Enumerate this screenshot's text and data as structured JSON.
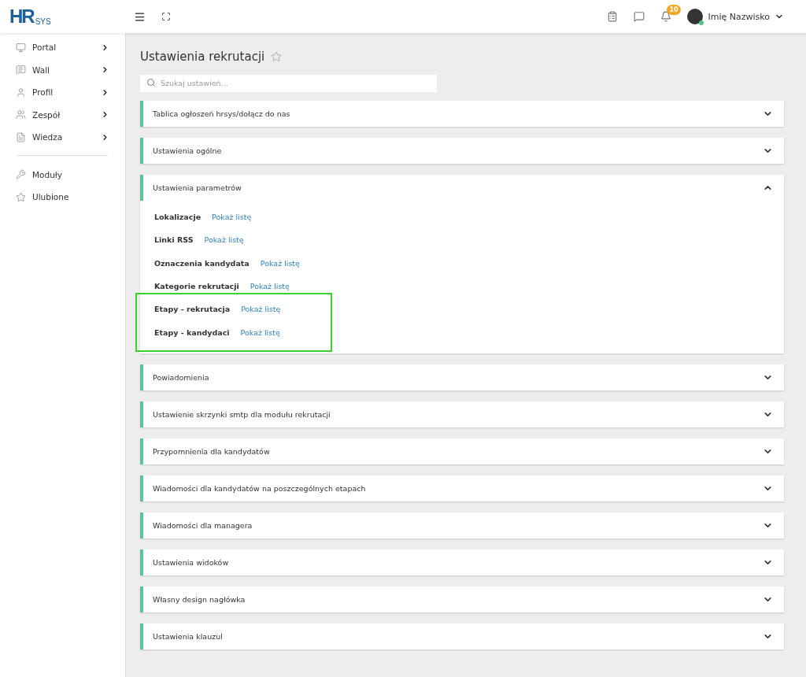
{
  "logo": {
    "main": "HR",
    "sub": "SYS"
  },
  "topbar": {
    "notification_count": "10",
    "user_name": "Imię Nazwisko"
  },
  "sidebar": {
    "items": [
      {
        "label": "Portal",
        "has_submenu": true
      },
      {
        "label": "Wall",
        "has_submenu": true
      },
      {
        "label": "Profil",
        "has_submenu": true
      },
      {
        "label": "Zespół",
        "has_submenu": true
      },
      {
        "label": "Wiedza",
        "has_submenu": true
      }
    ],
    "bottom_items": [
      {
        "label": "Moduły"
      },
      {
        "label": "Ulubione"
      }
    ]
  },
  "page": {
    "title": "Ustawienia rekrutacji",
    "search": {
      "placeholder": "Szukaj ustawień..."
    }
  },
  "sections": [
    {
      "title": "Tablica ogłoszeń hrsys/dołącz do nas",
      "expanded": false
    },
    {
      "title": "Ustawienia ogólne",
      "expanded": false
    },
    {
      "title": "Ustawienia parametrów",
      "expanded": true,
      "rows": [
        {
          "label": "Lokalizacje",
          "link": "Pokaż listę",
          "highlighted": false
        },
        {
          "label": "Linki RSS",
          "link": "Pokaż listę",
          "highlighted": false
        },
        {
          "label": "Oznaczenia kandydata",
          "link": "Pokaż listę",
          "highlighted": false
        },
        {
          "label": "Kategorie rekrutacji",
          "link": "Pokaż listę",
          "highlighted": false
        },
        {
          "label": "Etapy - rekrutacja",
          "link": "Pokaż listę",
          "highlighted": true
        },
        {
          "label": "Etapy - kandydaci",
          "link": "Pokaż listę",
          "highlighted": true
        }
      ]
    },
    {
      "title": "Powiadomienia",
      "expanded": false
    },
    {
      "title": "Ustawienie skrzynki smtp dla modułu rekrutacji",
      "expanded": false
    },
    {
      "title": "Przypomnienia dla kandydatów",
      "expanded": false
    },
    {
      "title": "Wiadomości dla kandydatów na poszczególnych etapach",
      "expanded": false
    },
    {
      "title": "Wiadomości dla managera",
      "expanded": false
    },
    {
      "title": "Ustawienia widoków",
      "expanded": false
    },
    {
      "title": "Własny design nagłówka",
      "expanded": false
    },
    {
      "title": "Ustawienia klauzul",
      "expanded": false
    }
  ]
}
